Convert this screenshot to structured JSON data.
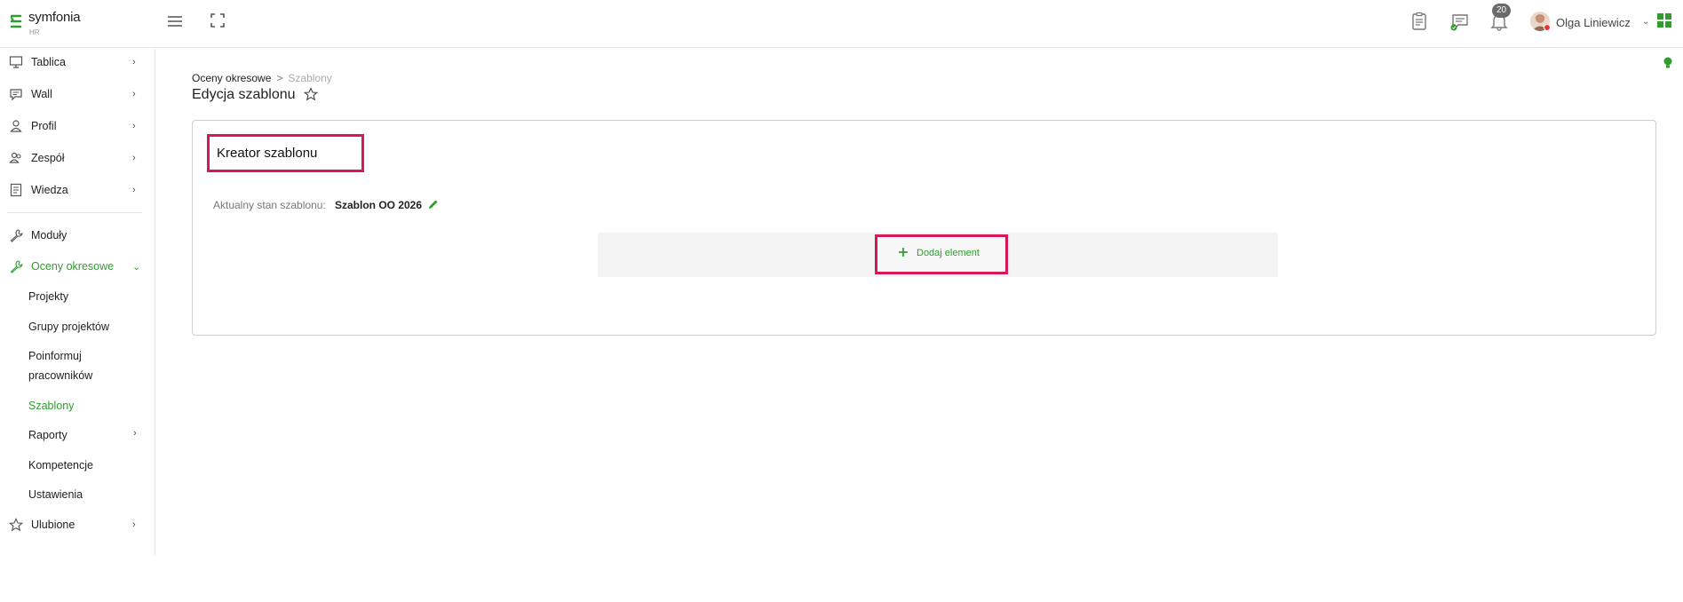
{
  "brand": {
    "name": "symfonia",
    "sub": "HR",
    "color": "#2f9e2f"
  },
  "header": {
    "notification_count": "20",
    "user_name": "Olga Liniewicz",
    "icons": [
      "menu-icon",
      "fullscreen-icon",
      "clipboard-icon",
      "chat-icon",
      "bell-icon",
      "apps-icon"
    ]
  },
  "sidebar": {
    "items": [
      {
        "label": "Tablica",
        "icon": "board-icon"
      },
      {
        "label": "Wall",
        "icon": "wall-icon"
      },
      {
        "label": "Profil",
        "icon": "user-icon"
      },
      {
        "label": "Zespół",
        "icon": "team-icon"
      },
      {
        "label": "Wiedza",
        "icon": "book-icon"
      },
      {
        "label": "Moduły",
        "icon": "wrench-icon"
      },
      {
        "label": "Oceny okresowe",
        "icon": "wrench-icon",
        "active": true
      },
      {
        "label": "Ulubione",
        "icon": "star-icon"
      }
    ],
    "sub_items": [
      {
        "label": "Projekty"
      },
      {
        "label": "Grupy projektów"
      },
      {
        "label": "Poinformuj"
      },
      {
        "label": "pracowników"
      },
      {
        "label": "Szablony",
        "active": true
      },
      {
        "label": "Raporty"
      },
      {
        "label": "Kompetencje"
      },
      {
        "label": "Ustawienia"
      }
    ]
  },
  "breadcrumb": {
    "parent": "Oceny okresowe",
    "separator": ">",
    "current": "Szablony"
  },
  "page": {
    "title": "Edycja szablonu"
  },
  "card": {
    "title": "Kreator szablonu",
    "state_label": "Aktualny stan szablonu:",
    "state_value": "Szablon OO 2026",
    "add_button": "Dodaj element"
  },
  "colors": {
    "accent": "#2f9e2f",
    "highlight": "#d6175a",
    "badge": "#6b6b6b"
  }
}
